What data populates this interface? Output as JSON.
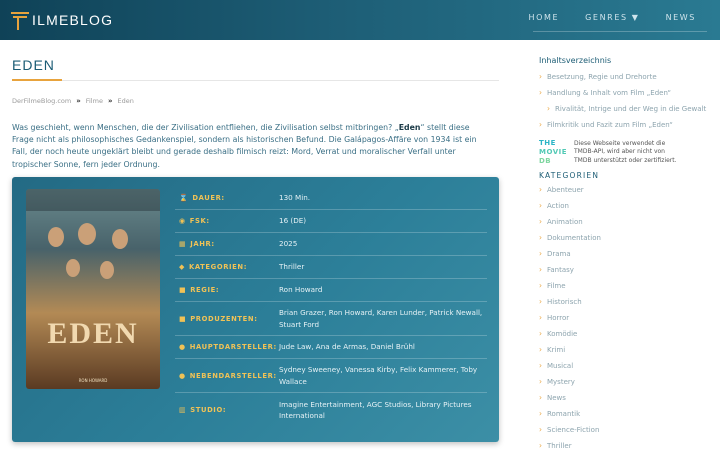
{
  "header": {
    "logo_text": "ILMEBLOG",
    "nav": [
      "HOME",
      "GENRES ▼",
      "NEWS"
    ]
  },
  "main": {
    "title": "EDEN",
    "breadcrumb": [
      "DerFilmeBlog.com",
      "Filme",
      "Eden"
    ],
    "intro_before": "Was geschieht, wenn Menschen, die der Zivilisation entfliehen, die Zivilisation selbst mitbringen? „",
    "intro_bold": "Eden",
    "intro_after": "“ stellt diese Frage nicht als philosophisches Gedankenspiel, sondern als historischen Befund. Die Galápagos-Affäre von 1934 ist ein Fall, der noch heute ungeklärt bleibt und gerade deshalb filmisch reizt: Mord, Verrat und moralischer Verfall unter tropischer Sonne, fern jeder Ordnung.",
    "poster": {
      "title": "EDEN",
      "footer": "RON HOWARD"
    },
    "details": [
      {
        "icon": "hourglass-icon",
        "glyph": "⌛",
        "label": "DAUER:",
        "value": "130 Min."
      },
      {
        "icon": "eye-icon",
        "glyph": "◉",
        "label": "FSK:",
        "value": "16 (DE)"
      },
      {
        "icon": "calendar-icon",
        "glyph": "▦",
        "label": "JAHR:",
        "value": "2025"
      },
      {
        "icon": "tags-icon",
        "glyph": "◆",
        "label": "KATEGORIEN:",
        "value": "Thriller"
      },
      {
        "icon": "camera-icon",
        "glyph": "■",
        "label": "REGIE:",
        "value": "Ron Howard"
      },
      {
        "icon": "video-icon",
        "glyph": "■",
        "label": "PRODUZENTEN:",
        "value": "Brian Grazer, Ron Howard, Karen Lunder, Patrick Newall, Stuart Ford"
      },
      {
        "icon": "user-icon",
        "glyph": "●",
        "label": "HAUPTDARSTELLER:",
        "value": "Jude Law, Ana de Armas, Daniel Brühl"
      },
      {
        "icon": "user-icon",
        "glyph": "●",
        "label": "NEBENDARSTELLER:",
        "value": "Sydney Sweeney, Vanessa Kirby, Felix Kammerer, Toby Wallace"
      },
      {
        "icon": "building-icon",
        "glyph": "▥",
        "label": "STUDIO:",
        "value": "Imagine Entertainment, AGC Studios, Library Pictures International"
      }
    ]
  },
  "sidebar": {
    "toc_title": "Inhaltsverzeichnis",
    "toc": [
      "Besetzung, Regie und Drehorte",
      "Handlung & Inhalt vom Film „Eden“",
      "Rivalität, Intrige und der Weg in die Gewalt",
      "Filmkritik und Fazit zum Film „Eden“"
    ],
    "tmdb_logo": [
      "THE",
      "MOVIE",
      "DB"
    ],
    "tmdb_note": "Diese Webseite verwendet die TMDB-API, wird aber nicht von TMDB unterstützt oder zertifiziert.",
    "categories_title": "KATEGORIEN",
    "categories": [
      "Abenteuer",
      "Action",
      "Animation",
      "Dokumentation",
      "Drama",
      "Fantasy",
      "Filme",
      "Historisch",
      "Horror",
      "Komödie",
      "Krimi",
      "Musical",
      "Mystery",
      "News",
      "Romantik",
      "Science-Fiction",
      "Thriller"
    ]
  },
  "colors": {
    "accent": "#e8a33d",
    "header_dark": "#0f4257",
    "card": "#2c7f99",
    "label_gold": "#f0c256"
  }
}
